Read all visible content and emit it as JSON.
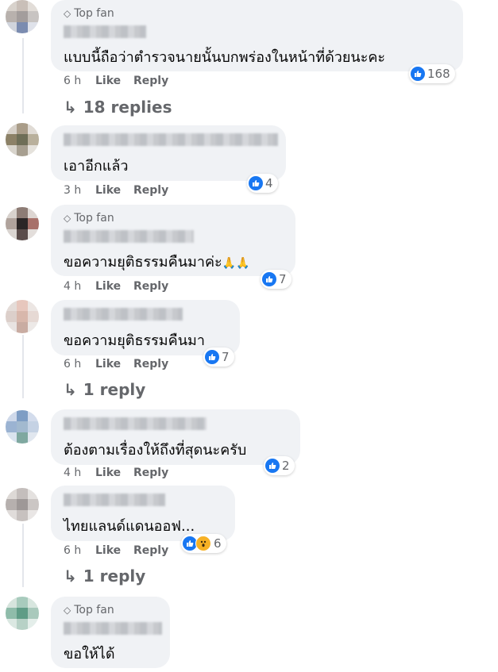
{
  "labels": {
    "top_fan": "Top fan",
    "like": "Like",
    "reply": "Reply"
  },
  "colors": {
    "like_blue": "#1877f2",
    "bubble_bg": "#f0f2f5",
    "meta_gray": "#65676b"
  },
  "comments": [
    {
      "top_fan": true,
      "text": "แบบนี้ถือว่าตำรวจนายนั้นบกพร่องในหน้าที่ด้วยนะคะ",
      "time": "6 h",
      "reactions": "168",
      "reaction_icons": [
        "like-icon"
      ],
      "replies": "18 replies"
    },
    {
      "top_fan": false,
      "text": "เอาอีกแล้ว",
      "time": "3 h",
      "reactions": "4",
      "reaction_icons": [
        "like-icon"
      ]
    },
    {
      "top_fan": true,
      "text": "ขอความยุติธรรมคืนมาค่ะ",
      "emoji": "🙏🙏",
      "time": "4 h",
      "reactions": "7",
      "reaction_icons": [
        "like-icon"
      ]
    },
    {
      "top_fan": false,
      "text": "ขอความยุติธรรมคืนมา",
      "time": "6 h",
      "reactions": "7",
      "reaction_icons": [
        "like-icon"
      ],
      "replies": "1 reply"
    },
    {
      "top_fan": false,
      "text": "ต้องตามเรื่องให้ถึงที่สุดนะครับ",
      "time": "4 h",
      "reactions": "2",
      "reaction_icons": [
        "like-icon"
      ]
    },
    {
      "top_fan": false,
      "text": "ไทยแลนด์แดนออฟ...",
      "time": "6 h",
      "reactions": "6",
      "reaction_icons": [
        "like-icon",
        "wow-icon"
      ],
      "replies": "1 reply"
    },
    {
      "top_fan": true,
      "text": "ขอให้ได้"
    }
  ]
}
